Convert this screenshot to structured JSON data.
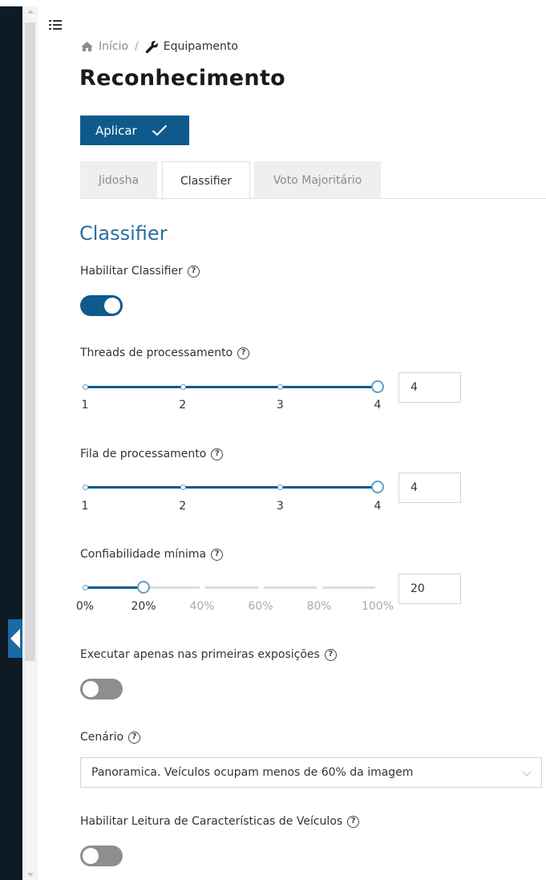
{
  "breadcrumb": {
    "home": "Início",
    "separator": "/",
    "current": "Equipamento"
  },
  "page_title": "Reconhecimento",
  "apply_button": "Aplicar",
  "tabs": [
    {
      "label": "Jidosha",
      "active": false
    },
    {
      "label": "Classifier",
      "active": true
    },
    {
      "label": "Voto Majoritário",
      "active": false
    }
  ],
  "section_title": "Classifier",
  "fields": {
    "enable_classifier": {
      "label": "Habilitar Classifier",
      "value": true
    },
    "threads": {
      "label": "Threads de processamento",
      "ticks": [
        "1",
        "2",
        "3",
        "4"
      ],
      "min": 1,
      "max": 4,
      "value": "4"
    },
    "queue": {
      "label": "Fila de processamento",
      "ticks": [
        "1",
        "2",
        "3",
        "4"
      ],
      "min": 1,
      "max": 4,
      "value": "4"
    },
    "min_confidence": {
      "label": "Confiabilidade mínima",
      "ticks": [
        "0%",
        "20%",
        "40%",
        "60%",
        "80%",
        "100%"
      ],
      "min": 0,
      "max": 100,
      "value": "20"
    },
    "first_exposures": {
      "label": "Executar apenas nas primeiras exposições",
      "value": false
    },
    "scenario": {
      "label": "Cenário",
      "value": "Panoramica. Veículos ocupam menos de 60% da imagem"
    },
    "vehicle_features": {
      "label": "Habilitar Leitura de Características de Veículos",
      "value": false
    }
  },
  "help_glyph": "?",
  "icons": [
    "menu-icon",
    "home-icon",
    "wrench-icon",
    "check-icon",
    "help-icon",
    "chevron-down-icon",
    "chevron-left-icon"
  ],
  "colors": {
    "primary": "#0f5a8c",
    "section_title": "#2a6e9c",
    "slider_dot": "#5e9fcc",
    "toggle_off": "#8e8e8e"
  }
}
